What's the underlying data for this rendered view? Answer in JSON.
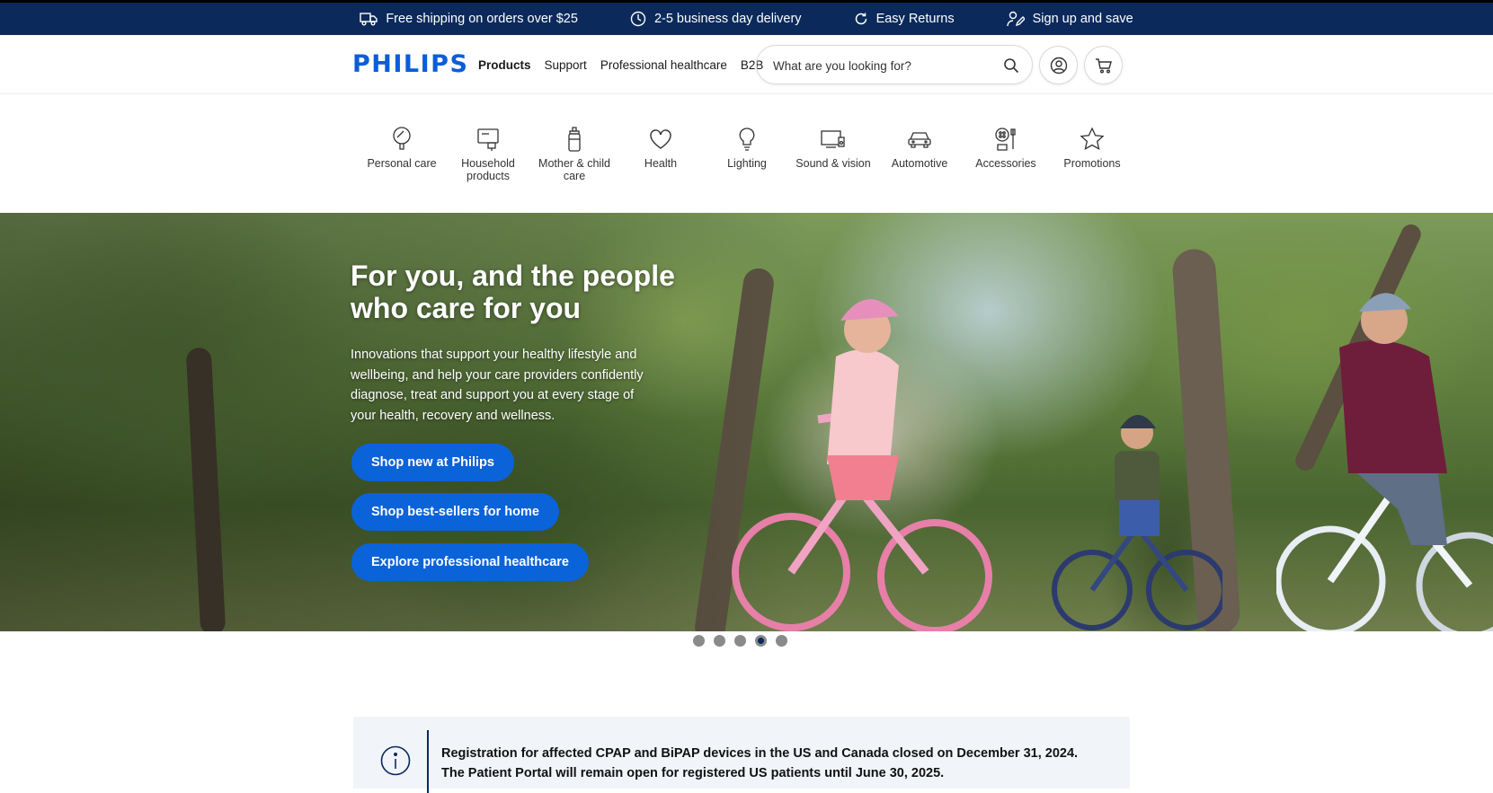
{
  "promo_bar": {
    "items": [
      {
        "icon": "truck-icon",
        "label": "Free shipping on orders over $25"
      },
      {
        "icon": "clock-icon",
        "label": "2-5 business day delivery"
      },
      {
        "icon": "refresh-icon",
        "label": "Easy Returns"
      },
      {
        "icon": "signup-icon",
        "label": "Sign up and save"
      }
    ],
    "background": "#0b2a5b"
  },
  "header": {
    "logo": "PHILIPS",
    "nav": [
      {
        "label": "Products",
        "active": true
      },
      {
        "label": "Support"
      },
      {
        "label": "Professional healthcare"
      },
      {
        "label": "B2B"
      }
    ],
    "search": {
      "placeholder": "What are you looking for?"
    },
    "account_icon": "user-icon",
    "cart_icon": "cart-icon",
    "brand_color": "#0b5ed7"
  },
  "categories": [
    {
      "label": "Personal care",
      "icon": "shaver-icon"
    },
    {
      "label": "Household products",
      "icon": "appliance-icon"
    },
    {
      "label": "Mother & child care",
      "icon": "baby-bottle-icon"
    },
    {
      "label": "Health",
      "icon": "heart-icon"
    },
    {
      "label": "Lighting",
      "icon": "bulb-icon"
    },
    {
      "label": "Sound & vision",
      "icon": "tv-icon"
    },
    {
      "label": "Automotive",
      "icon": "car-icon"
    },
    {
      "label": "Accessories",
      "icon": "accessories-icon"
    },
    {
      "label": "Promotions",
      "icon": "star-icon"
    }
  ],
  "hero": {
    "title": "For you, and the people who care for you",
    "text": "Innovations that support your healthy lifestyle and wellbeing, and help your care providers confidently diagnose, treat and support you at every stage of your health, recovery and wellness.",
    "buttons": [
      {
        "label": "Shop new at Philips"
      },
      {
        "label": "Shop best-sellers for home"
      },
      {
        "label": "Explore professional healthcare"
      }
    ],
    "button_color": "#0b63d9"
  },
  "carousel": {
    "count": 5,
    "active_index": 3
  },
  "notice": {
    "line1": "Registration for affected CPAP and BiPAP devices in the US and Canada closed on December 31, 2024.",
    "line2": "The Patient Portal will remain open for registered US patients until June 30, 2025.",
    "icon": "info-icon"
  }
}
